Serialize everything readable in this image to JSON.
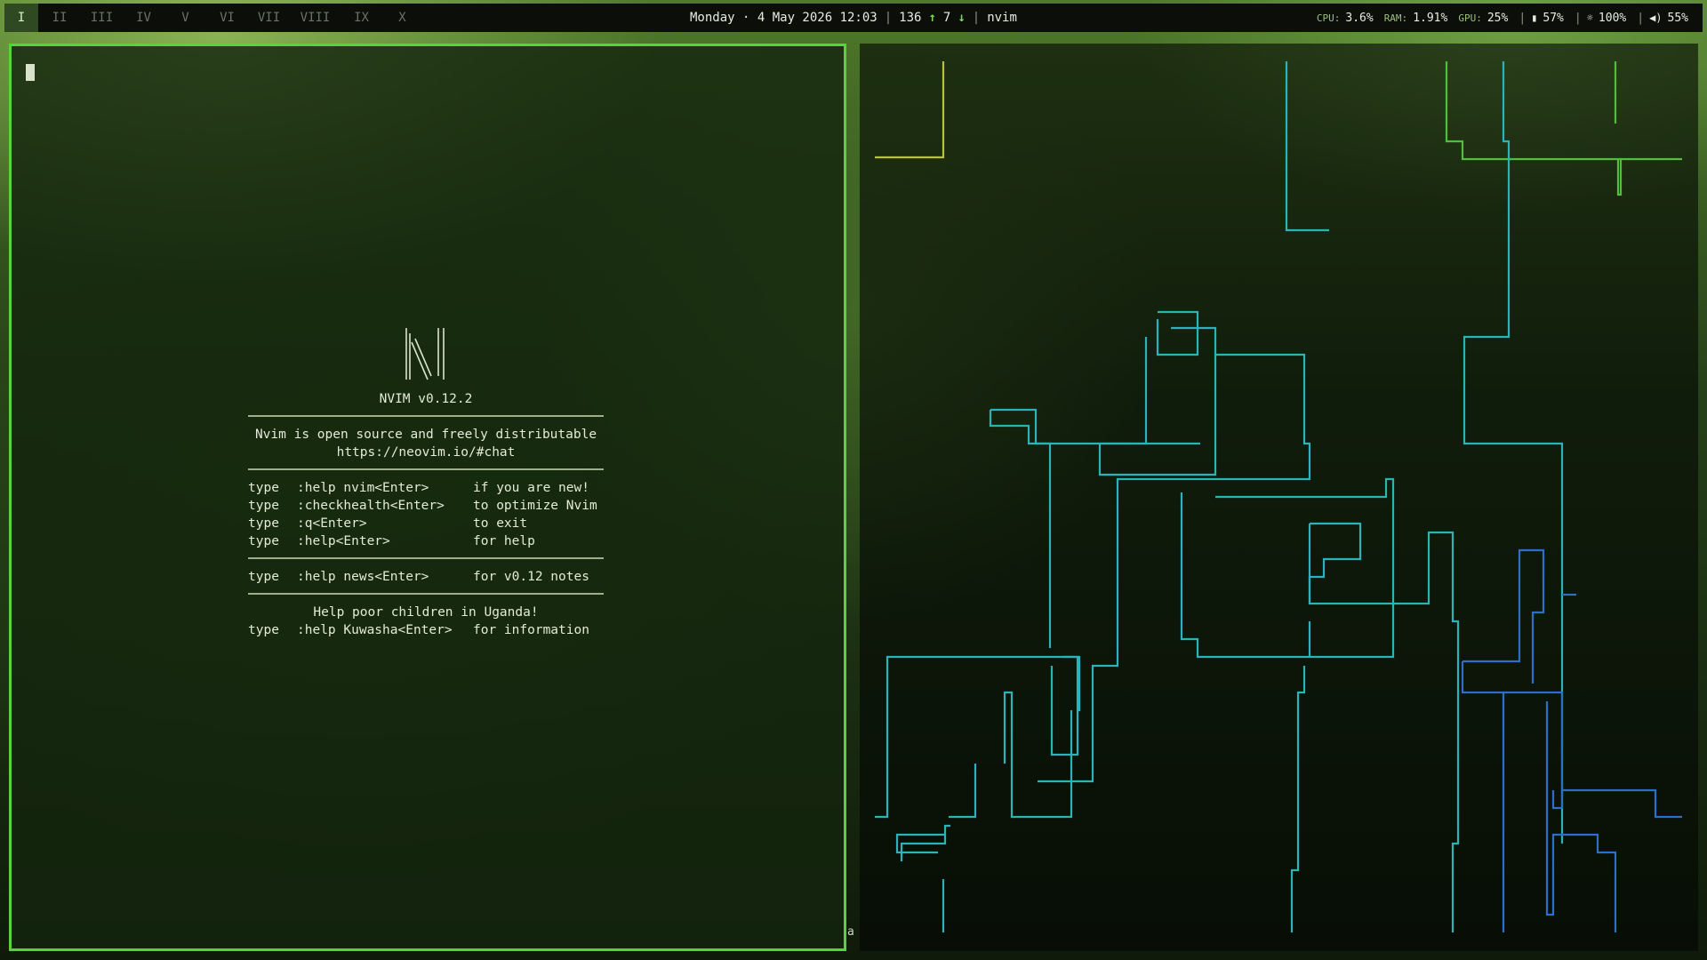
{
  "topbar": {
    "workspaces": [
      {
        "label": "I",
        "active": true
      },
      {
        "label": "II",
        "active": false
      },
      {
        "label": "III",
        "active": false
      },
      {
        "label": "IV",
        "active": false
      },
      {
        "label": "V",
        "active": false
      },
      {
        "label": "VI",
        "active": false
      },
      {
        "label": "VII",
        "active": false
      },
      {
        "label": "VIII",
        "active": false
      },
      {
        "label": "IX",
        "active": false
      },
      {
        "label": "X",
        "active": false
      }
    ],
    "clock": "Monday · 4 May 2026 12:03",
    "sep": "|",
    "net_up": "136",
    "net_down": "7",
    "window_title": "nvim",
    "cpu_label": "CPU:",
    "cpu": "3.6%",
    "ram_label": "RAM:",
    "ram": "1.91%",
    "gpu_label": "GPU:",
    "gpu": "25%",
    "battery": "57%",
    "brightness": "100%",
    "volume": "55%"
  },
  "nvim": {
    "version": "NVIM v0.12.2",
    "about1": "Nvim is open source and freely distributable",
    "about2": "https://neovim.io/#chat",
    "commands": [
      {
        "t": "type",
        "cmd": ":help nvim<Enter>",
        "desc": "if you are new!"
      },
      {
        "t": "type",
        "cmd": ":checkhealth<Enter>",
        "desc": "to optimize Nvim"
      },
      {
        "t": "type",
        "cmd": ":q<Enter>",
        "desc": "to exit"
      },
      {
        "t": "type",
        "cmd": ":help<Enter>",
        "desc": "for help"
      }
    ],
    "news": {
      "t": "type",
      "cmd": ":help news<Enter>",
      "desc": "for v0.12 notes"
    },
    "uganda": "Help poor children in Uganda!",
    "kuwasha": {
      "t": "type",
      "cmd": ":help Kuwasha<Enter>",
      "desc": "for information"
    },
    "mode_indicator": "a"
  },
  "colors": {
    "accent": "#57d43a",
    "pipe_teal": "#2ab3b8",
    "pipe_blue": "#2d6ec9",
    "pipe_green": "#4fbf3c",
    "pipe_yellow": "#b8c23a"
  },
  "icons": {
    "up": "arrow-up-icon",
    "down": "arrow-down-icon",
    "battery": "battery-icon",
    "brightness": "brightness-icon",
    "volume": "volume-icon"
  }
}
